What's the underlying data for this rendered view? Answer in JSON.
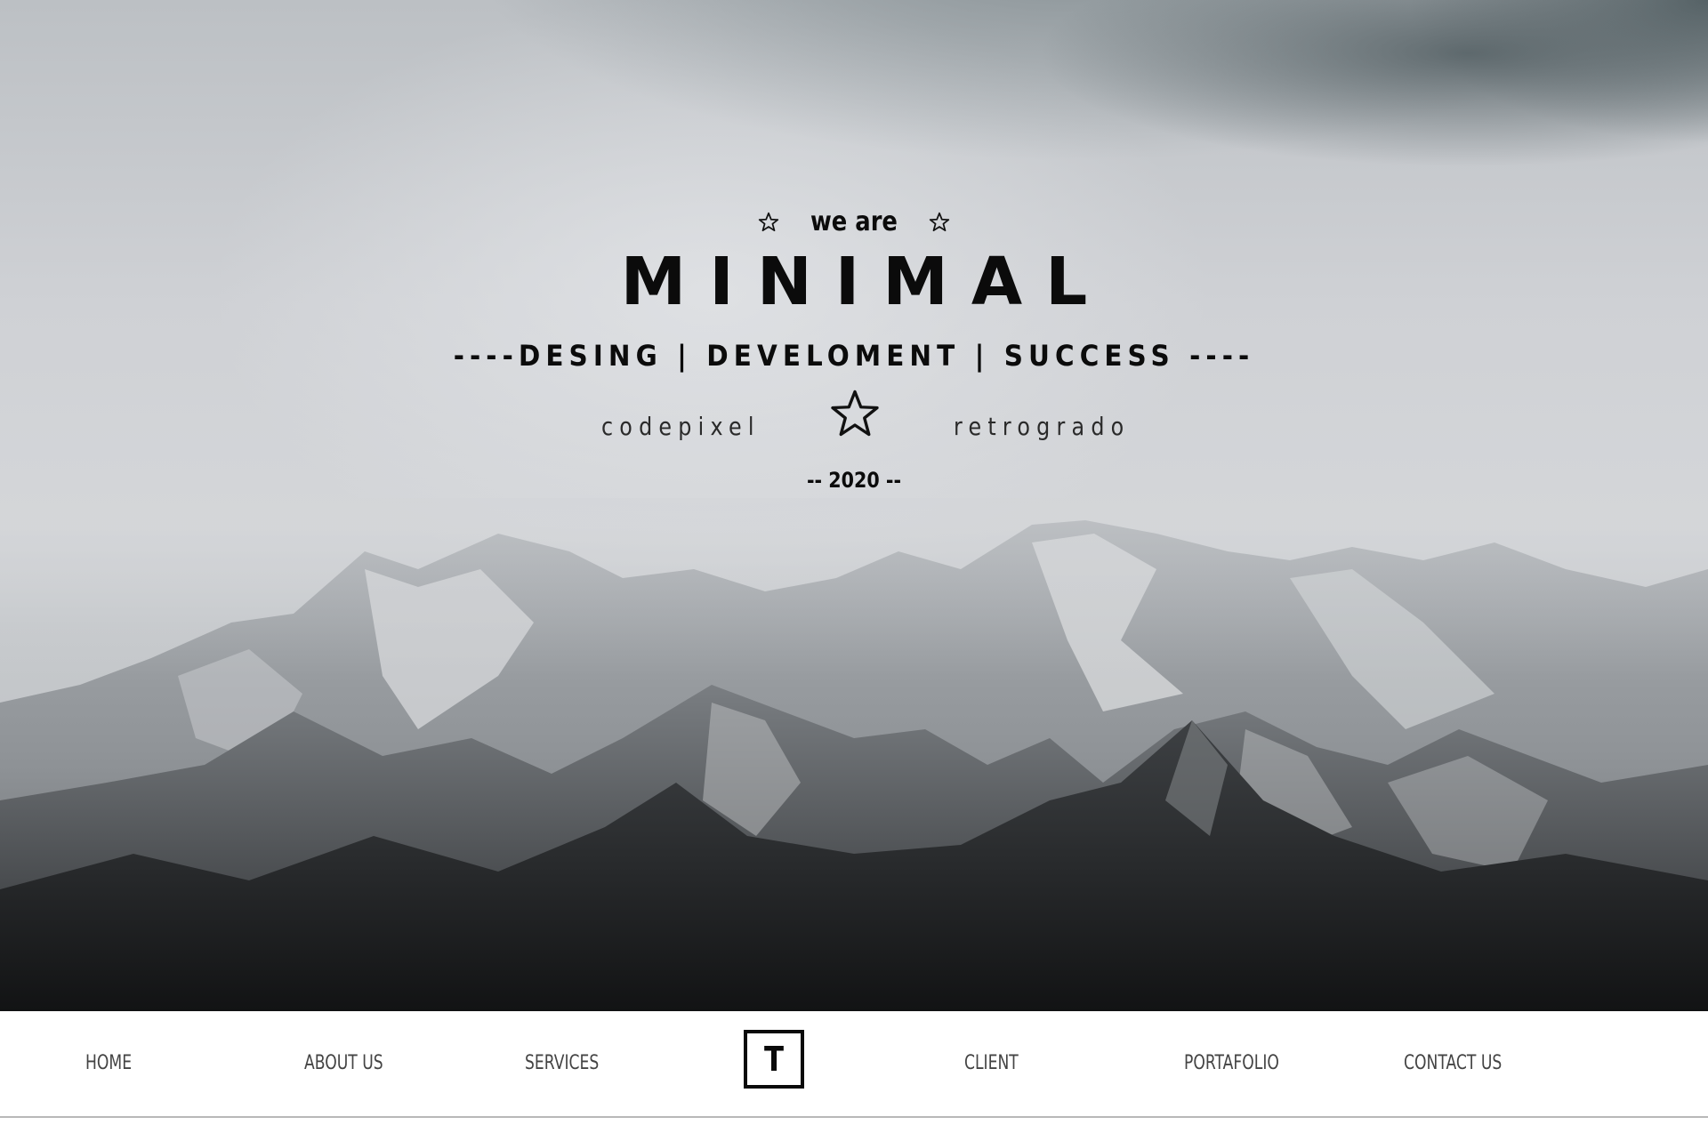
{
  "hero": {
    "intro": "we are",
    "title": "MINIMAL",
    "subtitle": "----DESING | DEVELOMENT | SUCCESS ----",
    "left_text": "codepixel",
    "right_text": "retrogrado",
    "year": "-- 2020 --",
    "icons": [
      "star-outline-icon",
      "star-outline-icon",
      "star-outline-icon"
    ],
    "background": "misty snowy mountain range under overcast sky"
  },
  "nav": {
    "items": [
      {
        "label": "HOME"
      },
      {
        "label": "ABOUT US"
      },
      {
        "label": "SERVICES"
      },
      {
        "label": "CLIENT"
      },
      {
        "label": "PORTAFOLIO"
      },
      {
        "label": "CONTACT US"
      }
    ],
    "logo_letter": "T"
  },
  "colors": {
    "text_dark": "#0b0b0b",
    "nav_text": "#444444",
    "nav_bg": "#ffffff"
  }
}
